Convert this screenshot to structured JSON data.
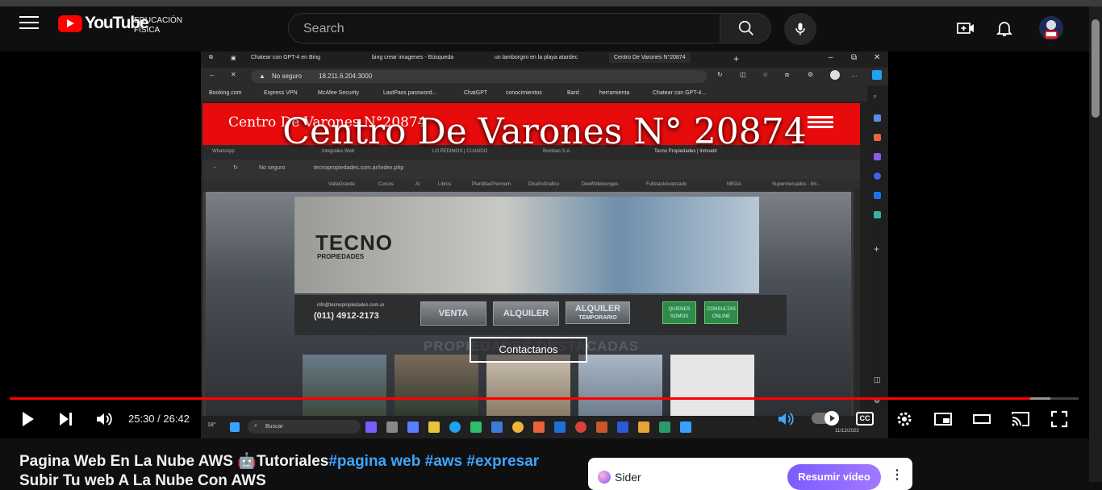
{
  "youtube": {
    "logo_text": "YouTube",
    "channel_sub_line1": "EDUCACIÓN",
    "channel_sub_line2": "FÍSICA",
    "search_placeholder": "Search"
  },
  "browser": {
    "tabs": [
      "Chatear con GPT-4 en Bing",
      "bing crear imagenes - Búsqueda",
      "un lamborgini en la playa atardec",
      "Centro De Varones N°20874"
    ],
    "address_prefix": "No seguro",
    "address": "18.211.6.204:3000",
    "bookmarks": [
      "Booking.com",
      "Express VPN",
      "McAfee Security",
      "LastPass password...",
      "ChatGPT",
      "conocimientos",
      "Bard",
      "herramienta",
      "Chatear con GPT-4..."
    ]
  },
  "site": {
    "header_title": "Centro De Varones N°20874",
    "hero_title": "Centro De Varones N° 20874",
    "contact_button": "Contactanos"
  },
  "inner": {
    "tabs": [
      "WhatsApp",
      "Integrales Web",
      "LO PEDIMOS | CUANDO",
      "Bombas S.A.",
      "Tecno Propiedades | Inmuebl"
    ],
    "address_prefix": "No seguro",
    "address": "tecnopropiedades.com.ar/index.php",
    "bookmarks": [
      "VallaGrande",
      "Cursos",
      "AI",
      "Libros",
      "PlantillasPremium",
      "DiseñoGrafico",
      "DevWidelounges",
      "FullstackAvanzado",
      "MEGA",
      "Supermercados - lim..."
    ],
    "logo_main": "TECNO",
    "logo_sub": "PROPIEDADES",
    "email": "info@tecnopropiedades.com.ar",
    "phone": "(011) 4912-2173",
    "nav_venta": "VENTA",
    "nav_alquiler": "ALQUILER",
    "nav_temporario_1": "ALQUILER",
    "nav_temporario_2": "TEMPORARIO",
    "green_quienes_1": "QUIENES",
    "green_quienes_2": "SOMOS",
    "green_consultas_1": "CONSULTAS",
    "green_consultas_2": "ONLINE",
    "destacadas": "PROPIEDADES DESTACADAS"
  },
  "taskbar": {
    "search_label": "Buscar",
    "clock": "11/12/2023",
    "weather_temp": "18°"
  },
  "player": {
    "time_display": "25:30 / 26:42",
    "progress": 0.955,
    "cc_label": "CC"
  },
  "video_title": {
    "prefix": "Pagina Web En La Nube AWS ",
    "emoji": "🤖",
    "word": "Tutoriales",
    "hashtags": "#pagina web #aws #expresar",
    "line2": "Subir Tu web A La Nube Con AWS"
  },
  "sider": {
    "label": "Sider",
    "button": "Resumir vídeo"
  },
  "colors": {
    "youtube_red": "#ff0000",
    "site_header_red": "#e80b0b",
    "hashtag_blue": "#3ea6ff",
    "sider_purple": "#7c5cff"
  }
}
